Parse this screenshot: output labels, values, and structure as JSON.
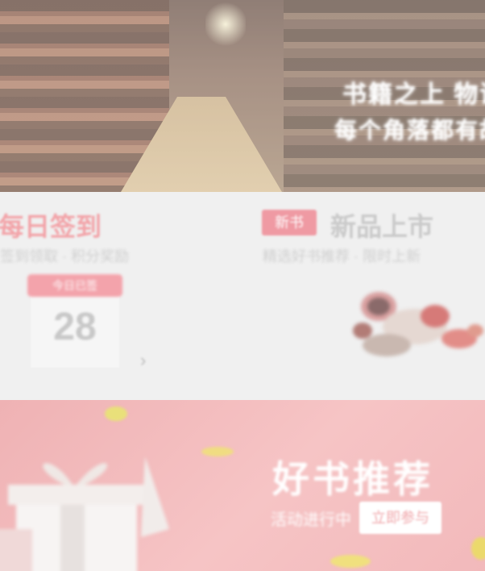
{
  "hero": {
    "line1": "书籍之上 物语",
    "line2": "每个角落都有故事"
  },
  "left_section": {
    "title": "每日签到",
    "subtitle": "签到领取 · 积分奖励",
    "calendar_header": "今日已签",
    "calendar_day": "28",
    "next_arrow": "›"
  },
  "right_section": {
    "tag": "新书",
    "title": "新品上市",
    "subtitle": "精选好书推荐 · 限时上新"
  },
  "banner": {
    "title": "好书推荐",
    "subtitle": "活动进行中",
    "button_label": "立即参与"
  },
  "colors": {
    "accent_pink": "#ef9aa3",
    "banner_pink": "#f2b9bb"
  }
}
